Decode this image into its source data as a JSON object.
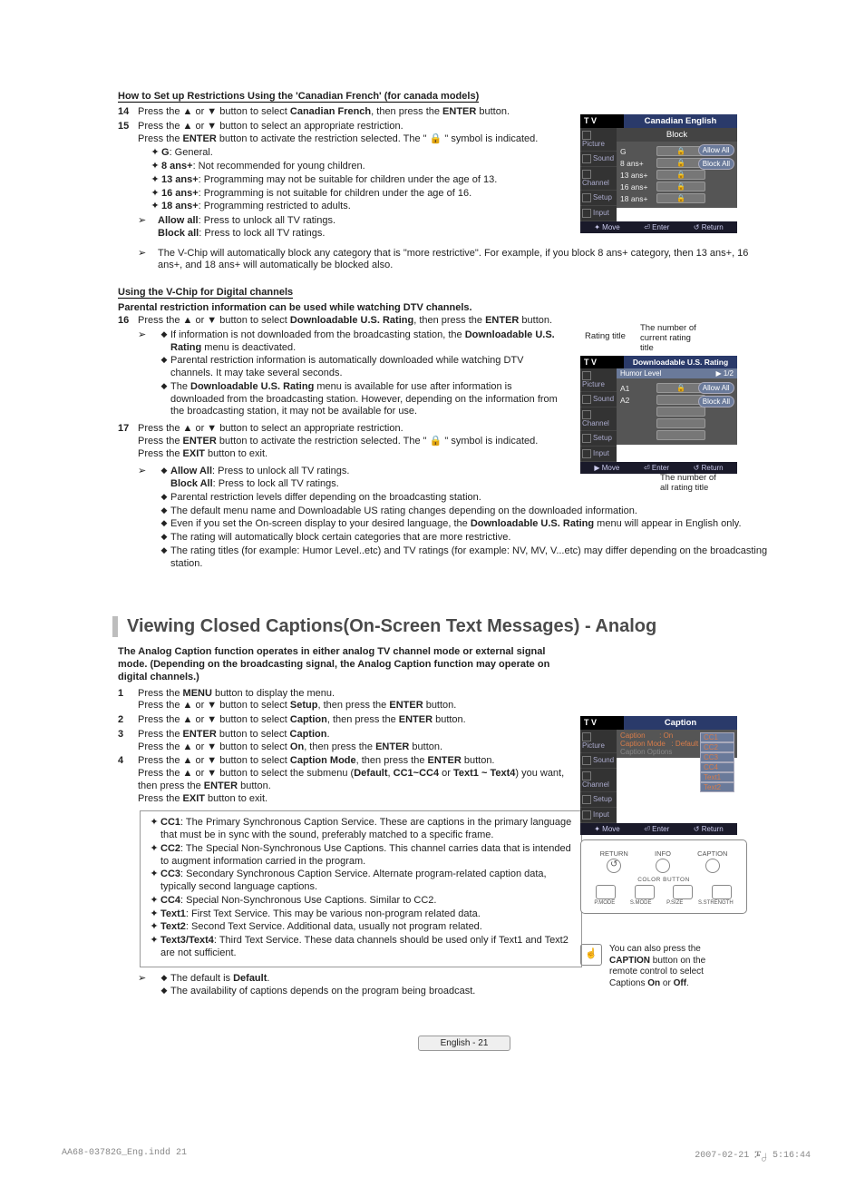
{
  "sec1": {
    "title": "How to Set up Restrictions Using the 'Canadian French' (for canada models)",
    "s14": {
      "a": "Press the ▲ or ▼ button to select ",
      "b": "Canadian French",
      "c": ", then press the ",
      "d": "ENTER",
      "e": " button."
    },
    "s15": {
      "a": "Press the ▲ or ▼ button to select an appropriate restriction.",
      "b1": "Press the ",
      "b2": "ENTER",
      "b3": " button to activate the restriction selected. The \" 🔒 \" symbol is indicated."
    },
    "bul": {
      "g": {
        "t": "G",
        "d": ": General."
      },
      "a8": {
        "t": "8 ans+",
        "d": ": Not recommended for young children."
      },
      "a13": {
        "t": "13 ans+",
        "d": ": Programming may not be suitable for children under the age of 13."
      },
      "a16": {
        "t": "16 ans+",
        "d": ": Programming is not suitable for children under the age of 16."
      },
      "a18": {
        "t": "18 ans+",
        "d": ": Programming restricted to adults."
      }
    },
    "ar1": {
      "a": "Allow all",
      "at": ": Press to unlock all TV ratings.",
      "b": "Block all",
      "bt": ": Press to lock all TV ratings."
    },
    "ar2": "The V-Chip will automatically block any category that is \"more restrictive\". For example, if you block 8 ans+ category, then 13 ans+, 16 ans+, and 18 ans+ will automatically be blocked also."
  },
  "sec2": {
    "title": "Using the V-Chip for Digital channels",
    "sub": "Parental restriction information can be used while watching DTV channels.",
    "s16": {
      "a": "Press the ▲ or ▼ button to select ",
      "b": "Downloadable U.S. Rating",
      "c": ", then press the ",
      "d": "ENTER",
      "e": " button."
    },
    "d1": {
      "a": "If information is not downloaded from the broadcasting station, the ",
      "b": "Downloadable U.S. Rating",
      "c": " menu is deactivated."
    },
    "d2": "Parental restriction information is automatically downloaded while watching DTV channels. It may take several seconds.",
    "d3": {
      "a": "The ",
      "b": "Downloadable U.S. Rating",
      "c": " menu is available for use after information is downloaded from the broadcasting station. However, depending on the information from the broadcasting station, it may not be available for use."
    },
    "s17": {
      "a": "Press the ▲ or ▼ button to select an appropriate restriction.",
      "b1": "Press the ",
      "b2": "ENTER",
      "b3": " button to activate the restriction selected. The \" 🔒 \" symbol is indicated.",
      "c1": "Press the ",
      "c2": "EXIT",
      "c3": " button to exit."
    },
    "ar": {
      "aa": {
        "t": "Allow All",
        "d": ": Press to unlock all TV ratings."
      },
      "ba": {
        "t": "Block All",
        "d": ": Press to lock all TV ratings."
      },
      "p2": "Parental restriction levels differ depending on the broadcasting station.",
      "p3": "The default menu name and Downloadable US rating changes depending on the downloaded information.",
      "p4a": "Even if you set the On-screen display to your desired language, the ",
      "p4b": "Downloadable U.S. Rating",
      "p4c": " menu will appear in English only.",
      "p5": "The rating will automatically block certain categories that are more restrictive.",
      "p6": "The rating titles (for example: Humor Level..etc) and TV ratings (for example: NV, MV, V...etc) may differ depending on the broadcasting station."
    }
  },
  "tv1": {
    "logo": "T V",
    "head": "Canadian English",
    "sub": "Block",
    "side": {
      "p": "Picture",
      "s": "Sound",
      "c": "Channel",
      "se": "Setup",
      "i": "Input"
    },
    "rows": [
      "G",
      "8  ans+",
      "13 ans+",
      "16 ans+",
      "18 ans+"
    ],
    "allow": "Allow All",
    "block": "Block All",
    "foot": {
      "m": "Move",
      "e": "Enter",
      "r": "Return"
    }
  },
  "tv2": {
    "logo": "T V",
    "head": "Downloadable U.S. Rating",
    "humor": "Humor Level",
    "page": "1/2",
    "rows": [
      "A1",
      "A2"
    ],
    "allow": "Allow All",
    "block": "Block All",
    "foot": {
      "m": "Move",
      "e": "Enter",
      "r": "Return"
    },
    "anno": {
      "rt": "Rating title",
      "nc": "The number of\ncurrent rating\ntitle",
      "na": "The number of\nall rating title"
    }
  },
  "cap": {
    "heading": "Viewing Closed Captions(On-Screen Text Messages) - Analog",
    "intro": "The Analog Caption function operates in either analog TV channel mode or external signal mode. (Depending on the broadcasting signal, the Analog Caption function may operate on digital channels.)",
    "s1": {
      "a": "Press the ",
      "b": "MENU",
      "c": " button to display the menu.",
      "d": "Press the ▲ or ▼ button to select ",
      "e": "Setup",
      "f": ", then press the ",
      "g": "ENTER",
      "h": " button."
    },
    "s2": {
      "a": "Press the ▲ or ▼ button to select ",
      "b": "Caption",
      "c": ", then press the ",
      "d": "ENTER",
      "e": " button."
    },
    "s3": {
      "a": "Press the ",
      "b": "ENTER",
      "c": " button to select ",
      "d": "Caption",
      "e": ".",
      "f": "Press the ▲ or ▼ button to select ",
      "g": "On",
      "h": ", then press the ",
      "i": "ENTER",
      "j": " button."
    },
    "s4": {
      "a": "Press the ▲ or ▼ button to select ",
      "b": "Caption Mode",
      "c": ", then press the ",
      "d": "ENTER",
      "e": " button.",
      "f": "Press the ▲ or ▼ button to select the submenu (",
      "g": "Default",
      "h": ", ",
      "i": "CC1~CC4",
      "j": " or ",
      "k": "Text1 ~ Text4",
      "l": ") you want, then press the ",
      "m": "ENTER",
      "n": " button.",
      "o": "Press the ",
      "p": "EXIT",
      "q": " button to exit."
    },
    "box": {
      "cc1": {
        "t": "CC1",
        "d": ": The Primary Synchronous Caption Service. These are captions in the primary language that must be in sync with the sound, preferably matched to a specific frame."
      },
      "cc2": {
        "t": "CC2",
        "d": ": The Special Non-Synchronous Use Captions. This channel carries data that is intended to augment information carried in the program."
      },
      "cc3": {
        "t": "CC3",
        "d": ": Secondary Synchronous Caption Service. Alternate program-related caption data, typically second language captions."
      },
      "cc4": {
        "t": "CC4",
        "d": ": Special Non-Synchronous Use Captions. Similar to CC2."
      },
      "t1": {
        "t": "Text1",
        "d": ": First Text Service. This may be various non-program related data."
      },
      "t2": {
        "t": "Text2",
        "d": ": Second Text Service. Additional data, usually not program related."
      },
      "t3": {
        "t": "Text3/Text4",
        "d": ": Third Text Service. These data channels should be used only if Text1 and Text2 are not sufficient."
      }
    },
    "ar": {
      "d1a": "The default is ",
      "d1b": "Default",
      "d1c": ".",
      "d2": "The availability of captions depends on the program being broadcast."
    }
  },
  "tv3": {
    "logo": "T V",
    "head": "Caption",
    "rows": {
      "cap": "Caption",
      "on": ": On",
      "mode": "Caption Mode",
      "def": ": Default",
      "opt": "Caption Options"
    },
    "opts": [
      "CC1",
      "CC2",
      "CC3",
      "CC4",
      "Text1",
      "Text2"
    ],
    "foot": {
      "m": "Move",
      "e": "Enter",
      "r": "Return"
    }
  },
  "remote": {
    "labels": {
      "ret": "RETURN",
      "info": "INFO",
      "cap": "CAPTION",
      "color": "COLOR BUTTON",
      "pm": "P.MODE",
      "sm": "S.MODE",
      "ps": "P.SIZE",
      "ss": "S.STRENGTH"
    }
  },
  "tip": {
    "a": "You can also press the ",
    "b": "CAPTION",
    "c": " button on the remote control to select Captions ",
    "d": "On",
    "e": " or ",
    "f": "Off",
    "g": "."
  },
  "pagelabel": "English - 21",
  "meta": {
    "file": "AA68-03782G_Eng.indd   21",
    "date": "2007-02-21   ᎎ႕ 5:16:44"
  }
}
